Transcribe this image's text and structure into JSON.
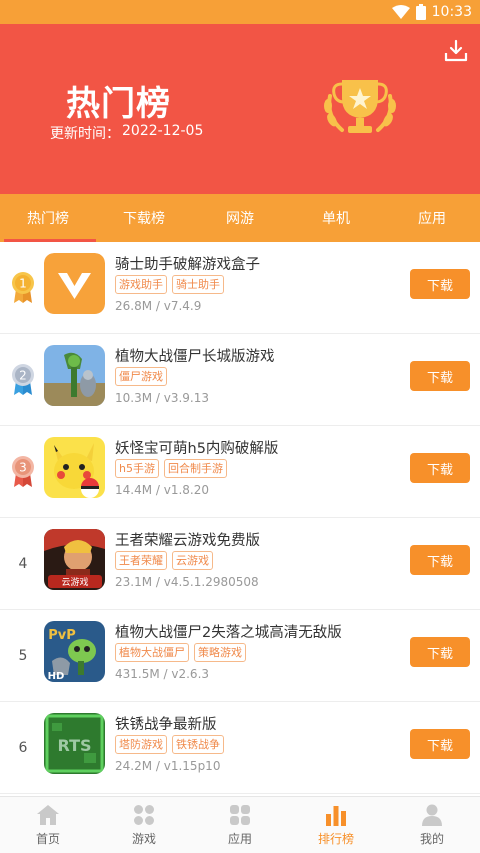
{
  "status": {
    "time": "10:33"
  },
  "header": {
    "title": "热门榜",
    "update_label": "更新时间：",
    "update_date": "2022-12-05"
  },
  "tabs": [
    {
      "label": "热门榜",
      "active": true
    },
    {
      "label": "下载榜"
    },
    {
      "label": "网游"
    },
    {
      "label": "单机"
    },
    {
      "label": "应用"
    }
  ],
  "apps": [
    {
      "rank": "1",
      "name": "骑士助手破解游戏盒子",
      "tags": [
        "游戏助手",
        "骑士助手"
      ],
      "meta": "26.8M / v7.4.9",
      "button": "下载"
    },
    {
      "rank": "2",
      "name": "植物大战僵尸长城版游戏",
      "tags": [
        "僵尸游戏"
      ],
      "meta": "10.3M / v3.9.13",
      "button": "下载"
    },
    {
      "rank": "3",
      "name": "妖怪宝可萌h5内购破解版",
      "tags": [
        "h5手游",
        "回合制手游"
      ],
      "meta": "14.4M / v1.8.20",
      "button": "下载"
    },
    {
      "rank": "4",
      "name": "王者荣耀云游戏免费版",
      "tags": [
        "王者荣耀",
        "云游戏"
      ],
      "meta": "23.1M / v4.5.1.2980508",
      "button": "下载"
    },
    {
      "rank": "5",
      "name": "植物大战僵尸2失落之城高清无敌版",
      "tags": [
        "植物大战僵尸",
        "策略游戏"
      ],
      "meta": "431.5M / v2.6.3",
      "button": "下载"
    },
    {
      "rank": "6",
      "name": "铁锈战争最新版",
      "tags": [
        "塔防游戏",
        "铁锈战争"
      ],
      "meta": "24.2M / v1.15p10",
      "button": "下载"
    }
  ],
  "app_icon_text": {
    "rts": "RTS",
    "hd": "HD",
    "pvp": "PvP",
    "cloud": "云游戏"
  },
  "bottom_nav": [
    {
      "label": "首页",
      "icon": "home-icon"
    },
    {
      "label": "游戏",
      "icon": "games-grid-icon"
    },
    {
      "label": "应用",
      "icon": "apps-grid-icon"
    },
    {
      "label": "排行榜",
      "icon": "ranking-bars-icon",
      "active": true
    },
    {
      "label": "我的",
      "icon": "profile-icon"
    }
  ],
  "colors": {
    "accent": "#f7902a",
    "header_red": "#f25545",
    "tab_orange": "#f7a037"
  }
}
